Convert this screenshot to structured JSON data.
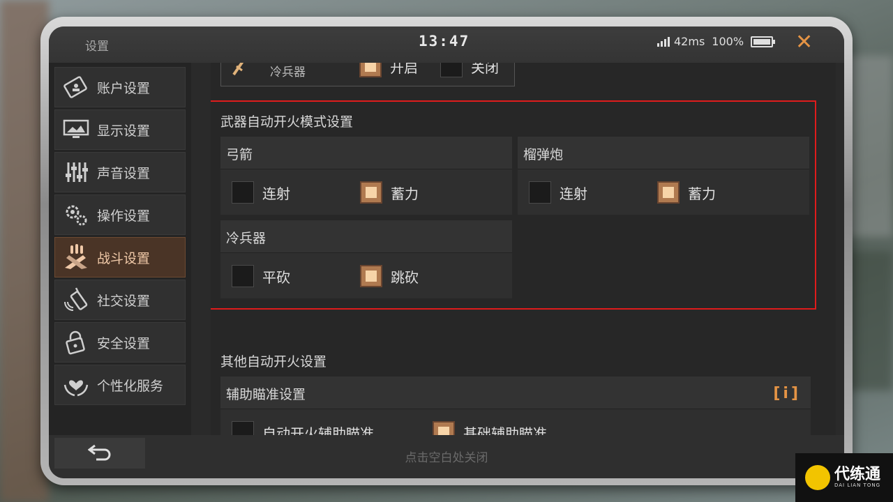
{
  "header": {
    "title": "设置",
    "clock": "13:47",
    "ping": "42ms",
    "battery": "100%",
    "close_icon": "close-icon",
    "accent": "#e59445"
  },
  "sidebar": {
    "items": [
      {
        "label": "账户设置",
        "icon": "account-card-icon",
        "active": false
      },
      {
        "label": "显示设置",
        "icon": "monitor-icon",
        "active": false
      },
      {
        "label": "声音设置",
        "icon": "sliders-icon",
        "active": false
      },
      {
        "label": "操作设置",
        "icon": "gears-icon",
        "active": false
      },
      {
        "label": "战斗设置",
        "icon": "weapons-icon",
        "active": true
      },
      {
        "label": "社交设置",
        "icon": "walkie-talkie-icon",
        "active": false
      },
      {
        "label": "安全设置",
        "icon": "lock-icon",
        "active": false
      },
      {
        "label": "个性化服务",
        "icon": "heart-hands-icon",
        "active": false
      }
    ]
  },
  "previous_row": {
    "label": "冷兵器",
    "option_on": "开启",
    "option_off": "关闭"
  },
  "weapon_fire_mode": {
    "title": "武器自动开火模式设置",
    "groups": [
      {
        "name": "弓箭",
        "options": [
          {
            "label": "连射",
            "checked": false
          },
          {
            "label": "蓄力",
            "checked": true
          }
        ]
      },
      {
        "name": "榴弹炮",
        "options": [
          {
            "label": "连射",
            "checked": false
          },
          {
            "label": "蓄力",
            "checked": true
          }
        ]
      },
      {
        "name": "冷兵器",
        "options": [
          {
            "label": "平砍",
            "checked": false
          },
          {
            "label": "跳砍",
            "checked": true
          }
        ]
      }
    ]
  },
  "other_fire": {
    "title": "其他自动开火设置",
    "aim_assist": {
      "name": "辅助瞄准设置",
      "info_icon": "info-icon",
      "options": [
        {
          "label": "自动开火辅助瞄准",
          "checked": false
        },
        {
          "label": "基础辅助瞄准",
          "checked": true
        }
      ]
    }
  },
  "footer": {
    "back_icon": "back-arrow-icon",
    "hint": "点击空白处关闭"
  },
  "watermark": {
    "name": "代练通",
    "sub": "DAI LIAN TONG"
  },
  "colors": {
    "highlight_border": "#e01c1c",
    "checkbox_on": "#f7d4a8",
    "active_tab": "#4a3426"
  }
}
